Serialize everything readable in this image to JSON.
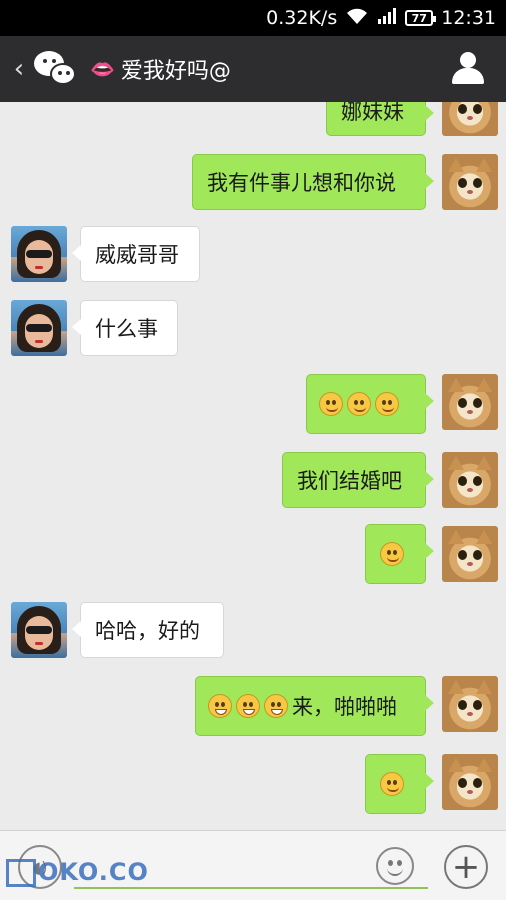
{
  "status": {
    "speed": "0.32K/s",
    "battery": "77",
    "time": "12:31"
  },
  "header": {
    "title": "爱我好吗@"
  },
  "messages": [
    {
      "side": "right",
      "text": "娜妹妹"
    },
    {
      "side": "right",
      "text": "我有件事儿想和你说"
    },
    {
      "side": "left",
      "text": "威威哥哥"
    },
    {
      "side": "left",
      "text": "什么事"
    },
    {
      "side": "right",
      "emoji": [
        "smirk",
        "smirk",
        "smirk"
      ]
    },
    {
      "side": "right",
      "text": "我们结婚吧"
    },
    {
      "side": "right",
      "emoji": [
        "smile"
      ]
    },
    {
      "side": "left",
      "text": "哈哈，好的"
    },
    {
      "side": "right",
      "emoji": [
        "grin",
        "grin",
        "grin"
      ],
      "text": "来，啪啪啪"
    },
    {
      "side": "right",
      "emoji": [
        "wink"
      ]
    }
  ],
  "watermark": "OKO.CO"
}
